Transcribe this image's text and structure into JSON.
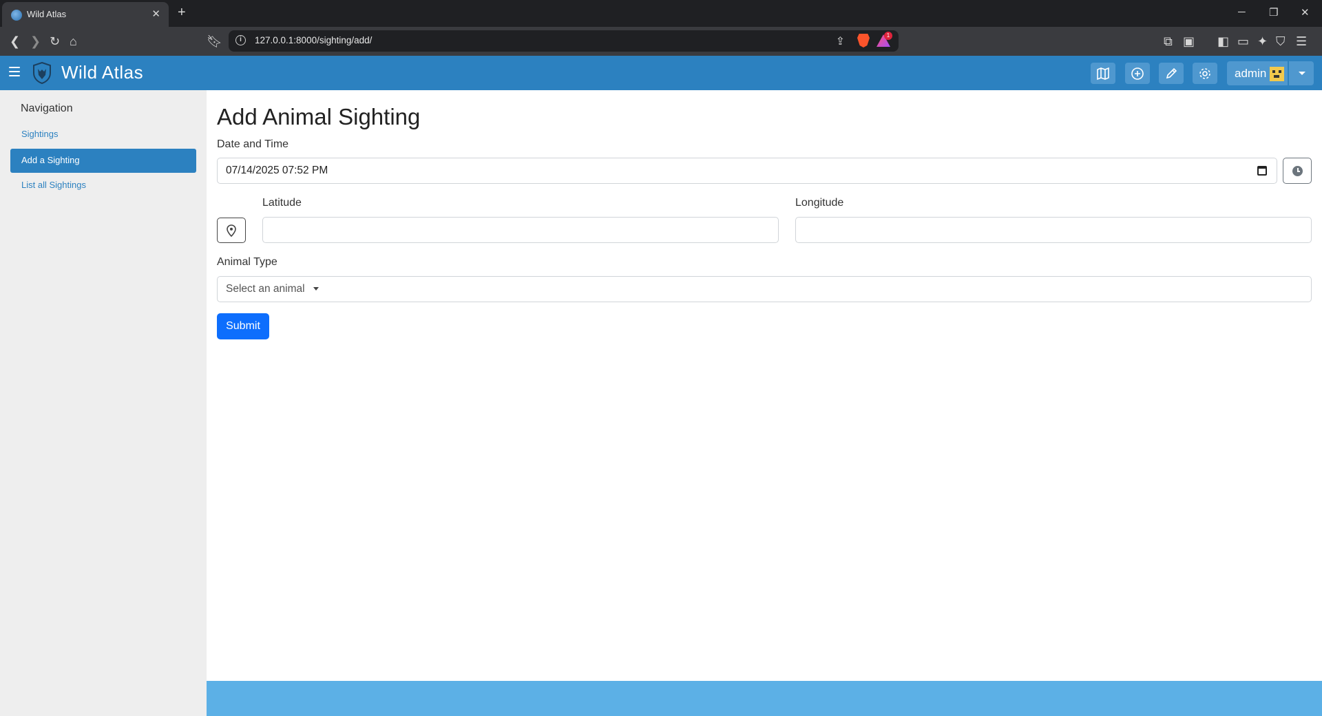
{
  "browser": {
    "tab_title": "Wild Atlas",
    "new_tab": "+",
    "url": "127.0.0.1:8000/sighting/add/",
    "notification_count": "1"
  },
  "app": {
    "brand": "Wild Atlas",
    "user": "admin",
    "colors": {
      "primary": "#2c81c0",
      "footer": "#5cb0e6",
      "submit": "#0d6efd"
    }
  },
  "sidebar": {
    "heading": "Navigation",
    "items": [
      {
        "label": "Sightings",
        "active": false
      },
      {
        "label": "Add a Sighting",
        "active": true
      },
      {
        "label": "List all Sightings",
        "active": false
      }
    ]
  },
  "form": {
    "title": "Add Animal Sighting",
    "datetime_label": "Date and Time",
    "datetime_value": "07/14/2025 07:52  PM",
    "latitude_label": "Latitude",
    "latitude_value": "",
    "longitude_label": "Longitude",
    "longitude_value": "",
    "animal_label": "Animal Type",
    "animal_placeholder": "Select an animal",
    "submit_label": "Submit"
  }
}
